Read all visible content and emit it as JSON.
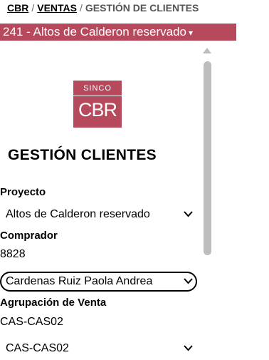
{
  "breadcrumb": {
    "root": "CBR",
    "section": "VENTAS",
    "current": "GESTIÓN DE CLIENTES",
    "separator": "/"
  },
  "project_selector": {
    "value": "241 - Altos de Calderon reservado",
    "caret": "▾"
  },
  "logo": {
    "top_text": "SINCO",
    "main_text": "CBR"
  },
  "page_title": "GESTIÓN CLIENTES",
  "form": {
    "proyecto_label": "Proyecto",
    "proyecto_value": "Altos de Calderon reservado",
    "comprador_label": "Comprador",
    "comprador_id": "8828",
    "comprador_name": "Cardenas Ruiz Paola Andrea",
    "agrupacion_label": "Agrupación de Venta",
    "agrupacion_input": "CAS-CAS02",
    "agrupacion_select": "CAS-CAS02"
  },
  "colors": {
    "brand": "#b6495c"
  }
}
